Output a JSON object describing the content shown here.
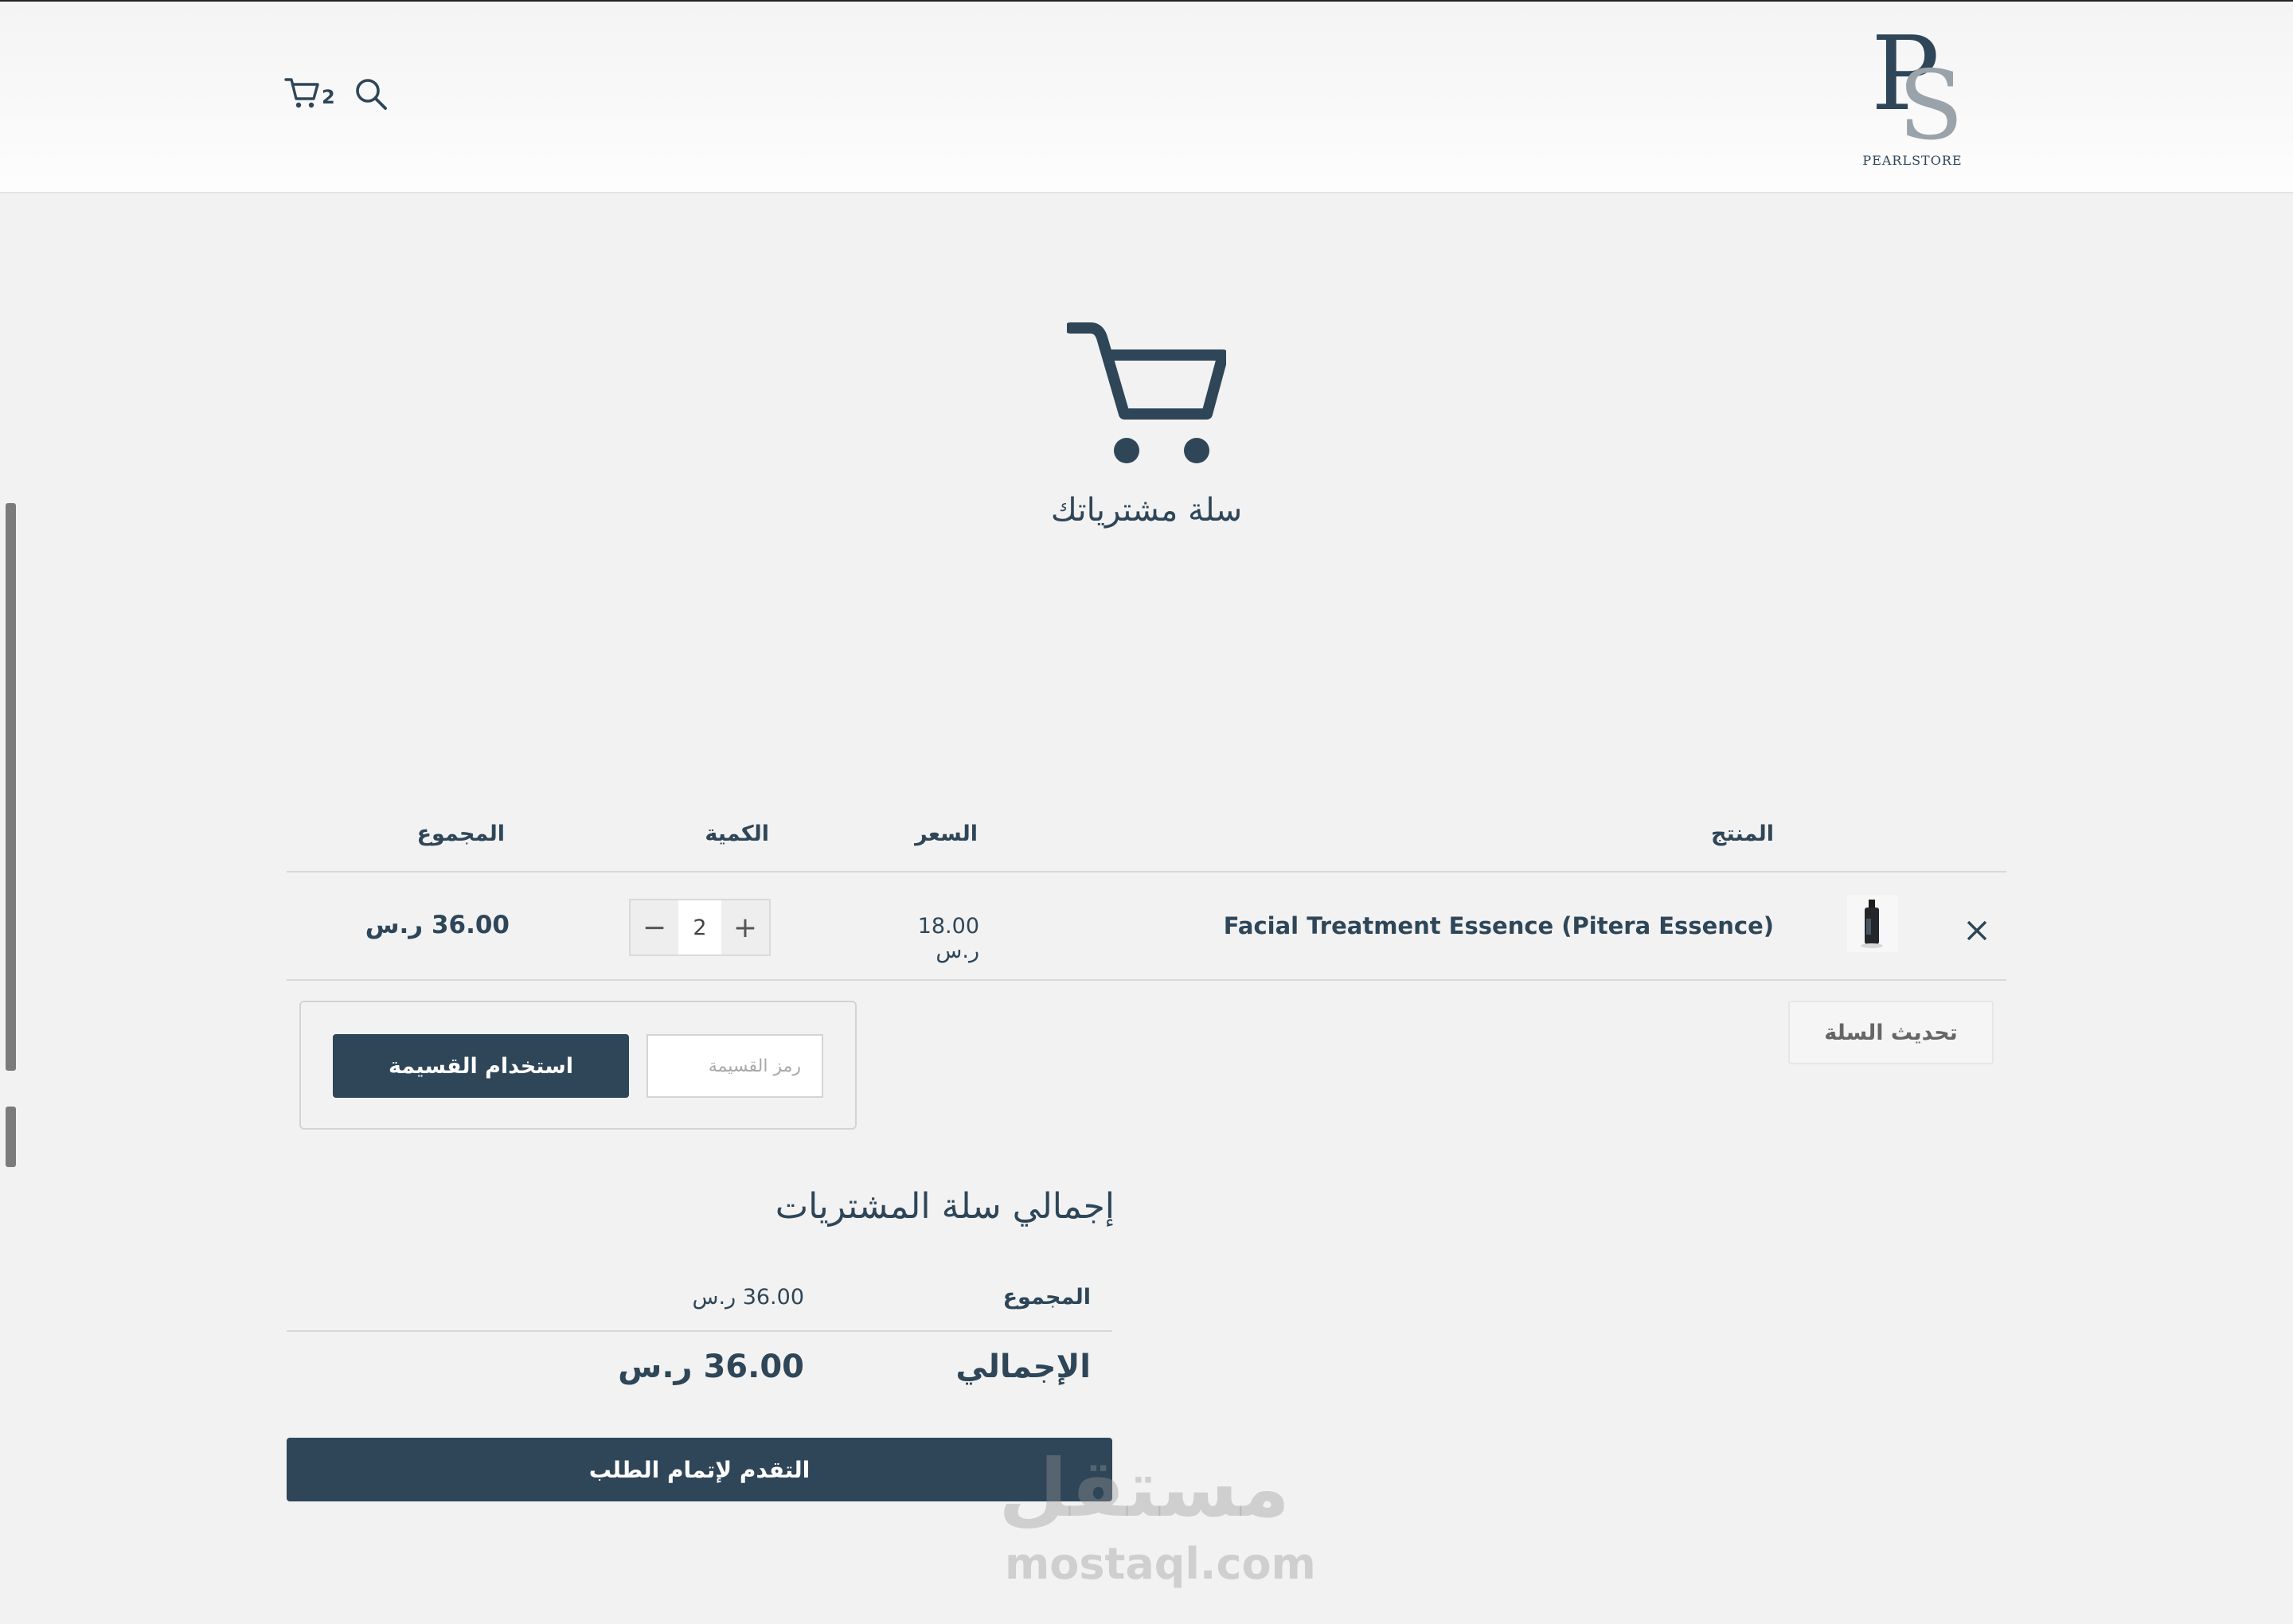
{
  "header": {
    "cart_count": "2",
    "logo": {
      "monogram_p": "P",
      "monogram_s": "S",
      "wordmark": "PEARLSTORE"
    }
  },
  "hero": {
    "title": "سلة مشترياتك"
  },
  "table": {
    "columns": {
      "product": "المنتج",
      "price": "السعر",
      "quantity": "الكمية",
      "total": "المجموع"
    },
    "rows": [
      {
        "name": "Facial Treatment Essence (Pitera Essence)",
        "price": "18.00 ر.س",
        "quantity": "2",
        "total": "36.00 ر.س"
      }
    ]
  },
  "actions": {
    "update_cart": "تحديث السلة",
    "coupon_placeholder": "رمز القسيمة",
    "apply_coupon": "استخدام القسيمة"
  },
  "totals": {
    "title": "إجمالي سلة المشتريات",
    "subtotal_label": "المجموع",
    "subtotal_value": "36.00 ر.س",
    "total_label": "الإجمالي",
    "total_value": "36.00 ر.س",
    "checkout": "التقدم لإتمام الطلب"
  },
  "watermark": {
    "arabic": "مستقل",
    "latin": "mostaql.com"
  },
  "colors": {
    "primary": "#2e4658",
    "background": "#f2f2f2"
  }
}
